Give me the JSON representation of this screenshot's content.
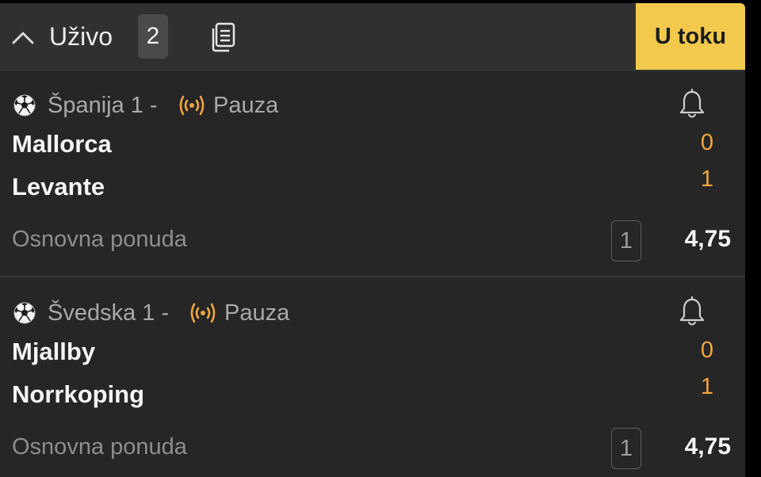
{
  "header": {
    "title": "Uživo",
    "count": "2",
    "live_tab_label": "U toku",
    "accent_color": "#f2c94c"
  },
  "events": [
    {
      "league": "Španija 1 -",
      "status": "Pauza",
      "home_team": "Mallorca",
      "away_team": "Levante",
      "home_score": "0",
      "away_score": "1",
      "market": "Osnovna ponuda",
      "outcome": "1",
      "odd": "4,75"
    },
    {
      "league": "Švedska 1 -",
      "status": "Pauza",
      "home_team": "Mjallby",
      "away_team": "Norrkoping",
      "home_score": "0",
      "away_score": "1",
      "market": "Osnovna ponuda",
      "outcome": "1",
      "odd": "4,75"
    }
  ],
  "icons": {
    "collapse": "chevron-up-icon",
    "copy": "copy-icon",
    "sport": "soccer-ball-icon",
    "live": "broadcast-icon",
    "notify": "bell-icon"
  },
  "colors": {
    "score": "#f0a640",
    "live_icon": "#f0a640"
  }
}
